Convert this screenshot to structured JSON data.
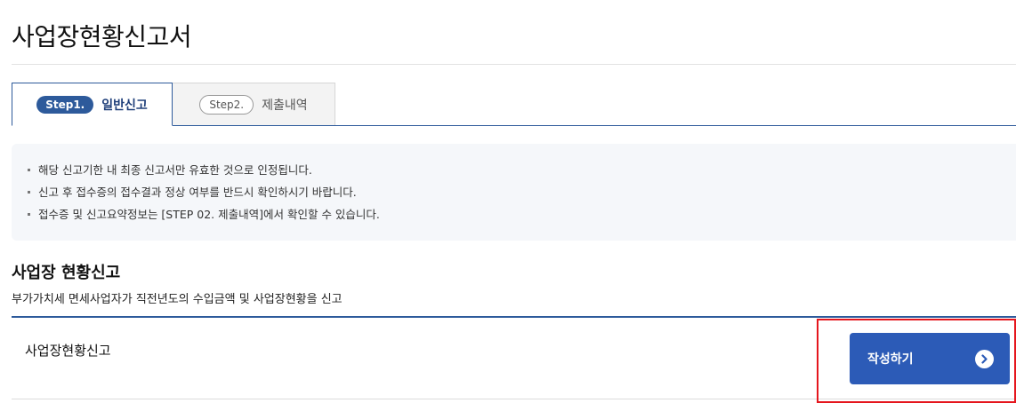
{
  "page": {
    "title": "사업장현황신고서"
  },
  "tabs": [
    {
      "step": "Step1.",
      "label": "일반신고",
      "active": true
    },
    {
      "step": "Step2.",
      "label": "제출내역",
      "active": false
    }
  ],
  "notice": {
    "items": [
      "해당 신고기한 내 최종 신고서만 유효한 것으로 인정됩니다.",
      "신고 후 접수증의 접수결과 정상 여부를 반드시 확인하시기 바랍니다.",
      "접수증 및 신고요약정보는 [STEP 02. 제출내역]에서 확인할 수 있습니다."
    ]
  },
  "section": {
    "title": "사업장 현황신고",
    "description": "부가가치세 면세사업자가 직전년도의 수입금액 및 사업장현황을 신고"
  },
  "row": {
    "label": "사업장현황신고",
    "button_label": "작성하기",
    "button_icon": "chevron-right-circle-icon"
  },
  "colors": {
    "primary": "#2d5a9b",
    "button": "#2c5bb7",
    "highlight": "#e5161d",
    "notice_bg": "#f5f7fa"
  }
}
